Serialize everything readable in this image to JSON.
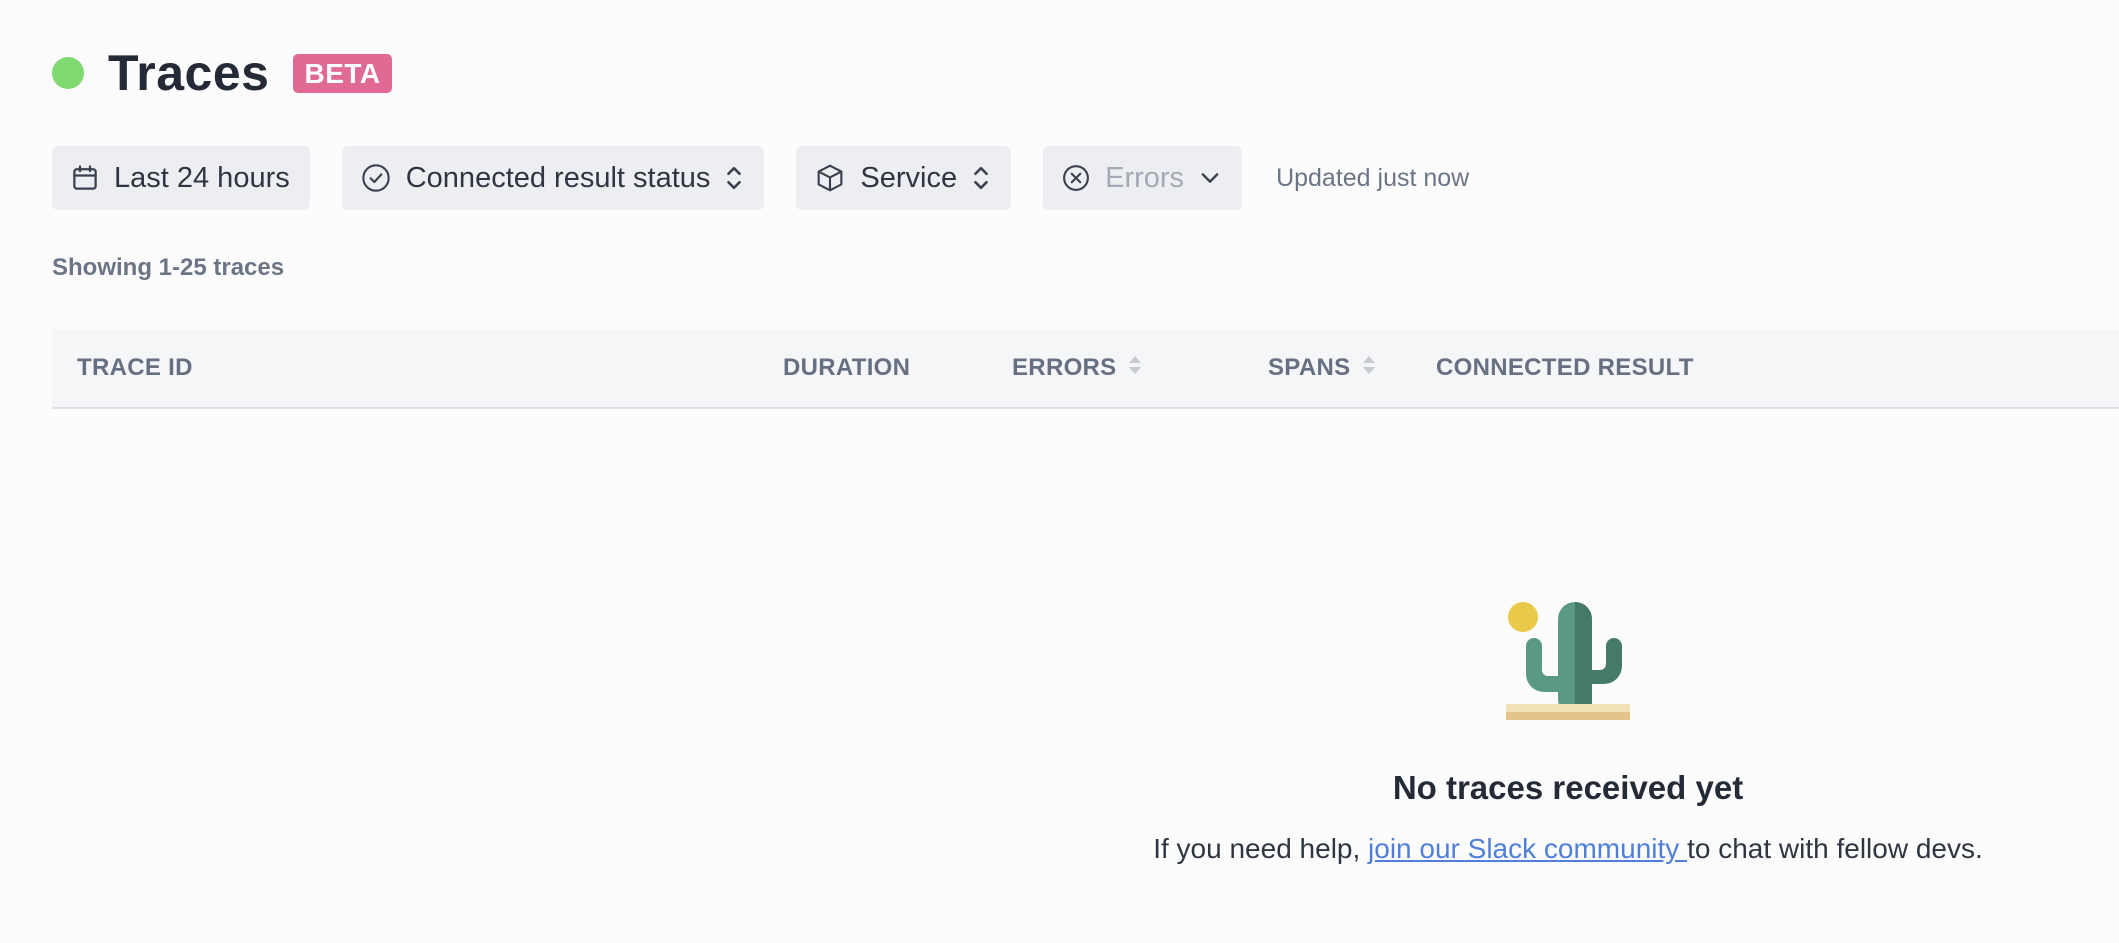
{
  "header": {
    "title": "Traces",
    "badge": "BETA"
  },
  "filters": {
    "time_range": "Last 24 hours",
    "connected_result_status": "Connected result status",
    "service": "Service",
    "errors_placeholder": "Errors",
    "updated": "Updated just now"
  },
  "table": {
    "showing": "Showing 1-25 traces",
    "columns": {
      "trace_id": "TRACE ID",
      "duration": "DURATION",
      "errors": "ERRORS",
      "spans": "SPANS",
      "connected_result": "CONNECTED RESULT"
    }
  },
  "empty": {
    "title": "No traces received yet",
    "text_before": "If you need help, ",
    "link": "join our Slack community ",
    "text_after": "to chat with fellow devs."
  },
  "colors": {
    "status_dot": "#7ed96f",
    "badge": "#e06a94",
    "link": "#4f7fd9"
  }
}
